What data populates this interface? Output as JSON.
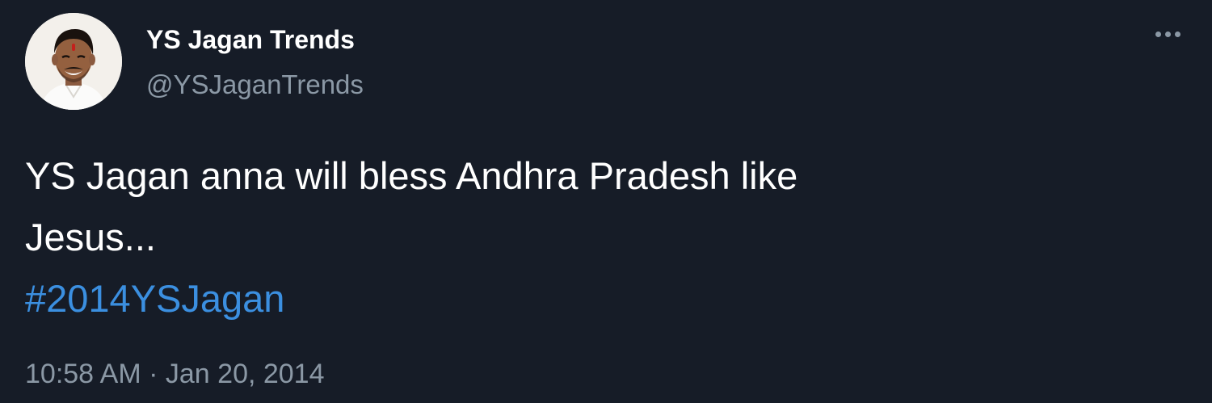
{
  "tweet": {
    "author": {
      "display_name": "YS Jagan Trends",
      "handle": "@YSJaganTrends",
      "avatar": "profile-photo"
    },
    "more_icon": "more-horizontal-icon",
    "text_lines": [
      "YS Jagan anna will bless Andhra Pradesh like",
      "Jesus..."
    ],
    "hashtag": "#2014YSJagan",
    "time": "10:58 AM",
    "separator": "·",
    "date": "Jan 20, 2014"
  },
  "colors": {
    "background": "#161c27",
    "text_primary": "#ffffff",
    "text_secondary": "#8b98a5",
    "link": "#3b8fe0"
  }
}
